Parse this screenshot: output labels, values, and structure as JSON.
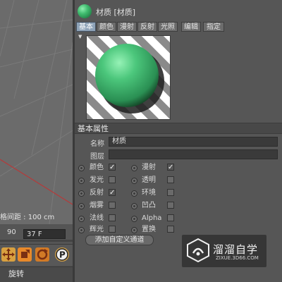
{
  "viewport": {
    "grid_spacing_text": "格间距 : 100 cm"
  },
  "timeline": {
    "left_frame": "90",
    "frame_value": "37 F"
  },
  "status_bar": {
    "text": "旋转"
  },
  "toolbar": {
    "tools": [
      "move-tool-icon",
      "scale-tool-icon",
      "rotate-tool-icon",
      "parking-icon"
    ]
  },
  "material": {
    "title": "材质 [材质]",
    "tabs": [
      "基本",
      "颜色",
      "漫射",
      "反射",
      "光照",
      "编辑",
      "指定"
    ],
    "active_tab": "基本",
    "section_title": "基本属性",
    "name_label": "名称",
    "name_value": "材质",
    "layer_label": "图层",
    "layer_value": "",
    "channels_left": [
      {
        "label": "颜色",
        "checked": true
      },
      {
        "label": "发光",
        "checked": false
      },
      {
        "label": "反射",
        "checked": true
      },
      {
        "label": "烟雾",
        "checked": false
      },
      {
        "label": "法线",
        "checked": false
      },
      {
        "label": "辉光",
        "checked": false
      }
    ],
    "channels_right": [
      {
        "label": "漫射",
        "checked": true
      },
      {
        "label": "透明",
        "checked": false
      },
      {
        "label": "环境",
        "checked": false
      },
      {
        "label": "凹凸",
        "checked": false
      },
      {
        "label": "Alpha",
        "checked": false
      },
      {
        "label": "置换",
        "checked": false
      }
    ],
    "custom_button": "添加自定义通道",
    "ball_color": "#3fbb6e"
  },
  "watermark": {
    "title": "溜溜自学",
    "sub": "ZIXUE.3D66.COM"
  }
}
